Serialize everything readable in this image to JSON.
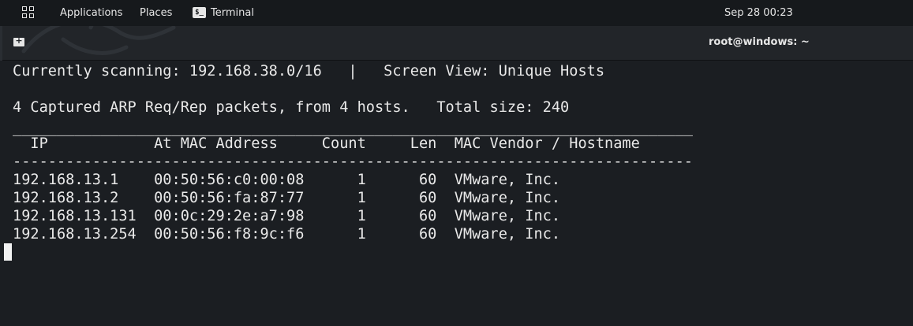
{
  "topbar": {
    "applications": "Applications",
    "places": "Places",
    "terminal": "Terminal",
    "terminal_icon_glyph": "$_",
    "clock": "Sep 28  00:23"
  },
  "window": {
    "title": "root@windows: ~"
  },
  "terminal": {
    "line1": "Currently scanning: 192.168.38.0/16   |   Screen View: Unique Hosts",
    "line2": "4 Captured ARP Req/Rep packets, from 4 hosts.   Total size: 240",
    "rule_top": "_____________________________________________________________________________",
    "header": "  IP            At MAC Address     Count     Len  MAC Vendor / Hostname",
    "rule_dash": "-----------------------------------------------------------------------------",
    "rows": [
      "192.168.13.1    00:50:56:c0:00:08      1      60  VMware, Inc.",
      "192.168.13.2    00:50:56:fa:87:77      1      60  VMware, Inc.",
      "192.168.13.131  00:0c:29:2e:a7:98      1      60  VMware, Inc.",
      "192.168.13.254  00:50:56:f8:9c:f6      1      60  VMware, Inc."
    ]
  }
}
